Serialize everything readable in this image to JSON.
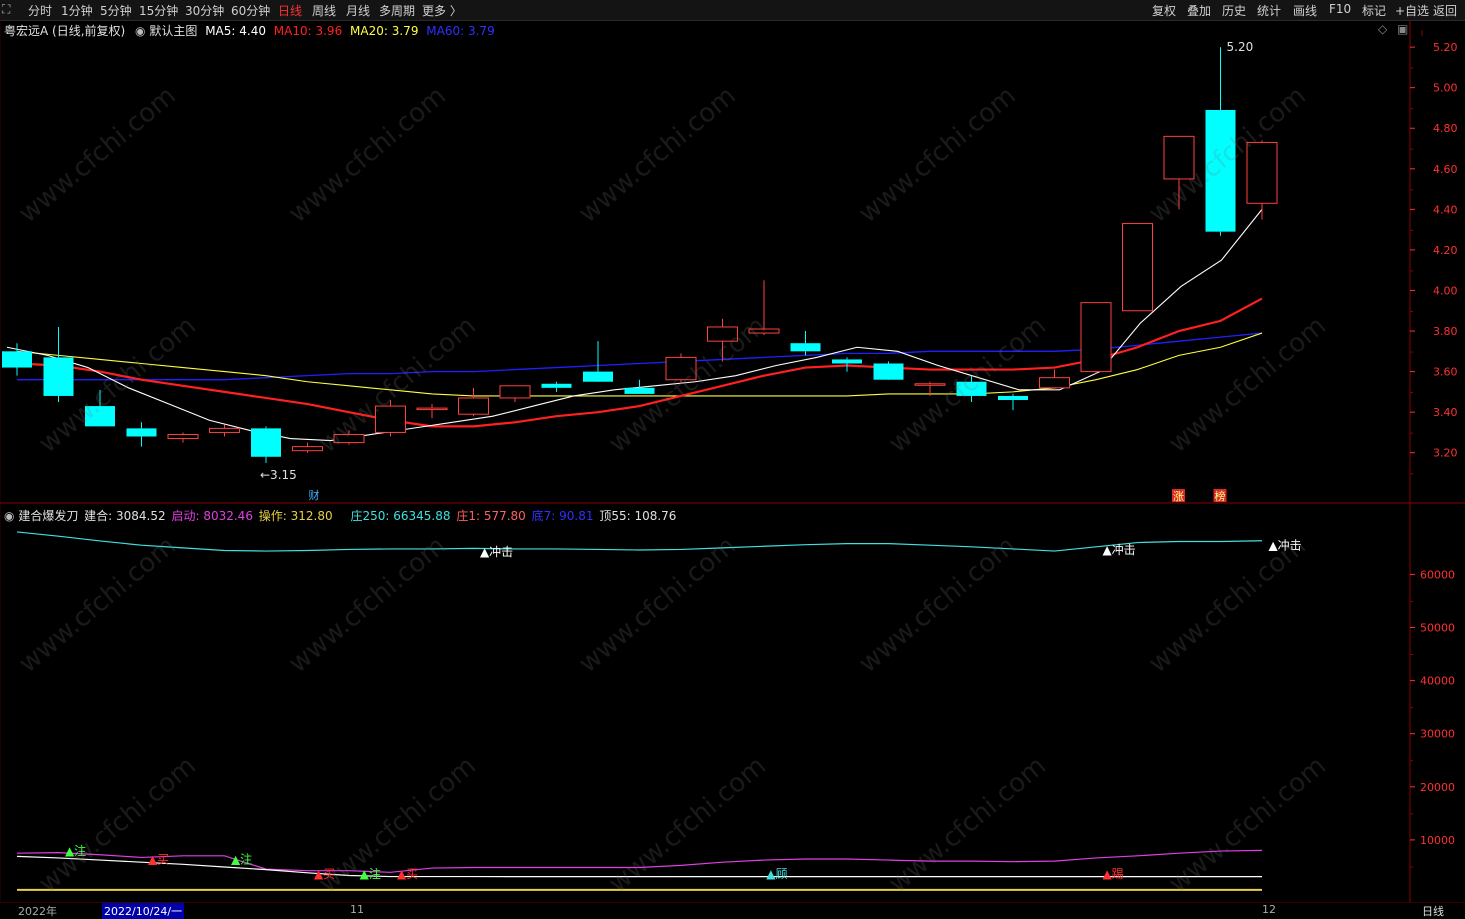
{
  "toolbar": {
    "periods": [
      "分时",
      "1分钟",
      "5分钟",
      "15分钟",
      "30分钟",
      "60分钟",
      "日线",
      "周线",
      "月线",
      "多周期",
      "更多 〉"
    ],
    "active_period": "日线",
    "right": [
      "复权",
      "叠加",
      "历史",
      "统计",
      "画线",
      "F10",
      "标记",
      "+自选",
      "返回"
    ]
  },
  "main_info": {
    "stock": "粤宏远A (日线,前复权)",
    "indicator": "默认主图",
    "ma5": "MA5: 4.40",
    "ma10": "MA10: 3.96",
    "ma20": "MA20: 3.79",
    "ma60": "MA60: 3.79"
  },
  "sub_info": {
    "name": "建合爆发刀",
    "jianhe": "建合: 3084.52",
    "qidong": "启动: 8032.46",
    "caozuo": "操作: 312.80",
    "zhuang250": "庄250: 66345.88",
    "zhuang1": "庄1: 577.80",
    "di7": "底7: 90.81",
    "ding55": "顶55: 108.76"
  },
  "colors": {
    "up": "#ff4040",
    "down": "#00ffff",
    "ma5": "#ffffff",
    "ma10": "#ff2020",
    "ma20": "#ffff40",
    "ma60": "#2020ff",
    "axis": "#ff3030",
    "qidong": "#e040e0",
    "caozuo": "#e8d040"
  },
  "chart_data": [
    {
      "type": "candlestick",
      "title": "粤宏远A (日线,前复权)",
      "y_ticks": [
        5.2,
        5.0,
        4.8,
        4.6,
        4.4,
        4.2,
        4.0,
        3.8,
        3.6,
        3.4,
        3.2
      ],
      "ylim": [
        3.1,
        5.24
      ],
      "ohlc": [
        [
          3.7,
          3.74,
          3.58,
          3.62
        ],
        [
          3.67,
          3.82,
          3.45,
          3.48
        ],
        [
          3.43,
          3.51,
          3.33,
          3.33
        ],
        [
          3.32,
          3.35,
          3.23,
          3.28
        ],
        [
          3.27,
          3.3,
          3.25,
          3.29
        ],
        [
          3.3,
          3.34,
          3.28,
          3.32
        ],
        [
          3.32,
          3.33,
          3.15,
          3.18
        ],
        [
          3.21,
          3.25,
          3.2,
          3.23
        ],
        [
          3.25,
          3.31,
          3.24,
          3.29
        ],
        [
          3.3,
          3.46,
          3.28,
          3.43
        ],
        [
          3.42,
          3.44,
          3.37,
          3.42
        ],
        [
          3.39,
          3.52,
          3.38,
          3.47
        ],
        [
          3.47,
          3.53,
          3.45,
          3.53
        ],
        [
          3.54,
          3.55,
          3.5,
          3.52
        ],
        [
          3.6,
          3.75,
          3.58,
          3.55
        ],
        [
          3.52,
          3.56,
          3.5,
          3.49
        ],
        [
          3.56,
          3.69,
          3.54,
          3.67
        ],
        [
          3.75,
          3.86,
          3.65,
          3.82
        ],
        [
          3.79,
          4.05,
          3.78,
          3.81
        ],
        [
          3.74,
          3.8,
          3.68,
          3.7
        ],
        [
          3.66,
          3.67,
          3.6,
          3.64
        ],
        [
          3.64,
          3.65,
          3.58,
          3.56
        ],
        [
          3.54,
          3.55,
          3.48,
          3.54
        ],
        [
          3.55,
          3.58,
          3.45,
          3.48
        ],
        [
          3.48,
          3.49,
          3.41,
          3.46
        ],
        [
          3.52,
          3.61,
          3.51,
          3.57
        ],
        [
          3.6,
          3.94,
          3.59,
          3.94
        ],
        [
          3.9,
          4.33,
          3.9,
          4.33
        ],
        [
          4.55,
          4.76,
          4.4,
          4.76
        ],
        [
          4.89,
          5.2,
          4.27,
          4.29
        ],
        [
          4.43,
          4.74,
          4.35,
          4.73
        ]
      ],
      "ma5": [
        3.72,
        3.68,
        3.62,
        3.52,
        3.44,
        3.36,
        3.31,
        3.27,
        3.26,
        3.29,
        3.32,
        3.35,
        3.38,
        3.43,
        3.48,
        3.51,
        3.53,
        3.55,
        3.58,
        3.63,
        3.67,
        3.72,
        3.7,
        3.63,
        3.57,
        3.51,
        3.51,
        3.6,
        3.84,
        4.02,
        4.15,
        4.4
      ],
      "ma10": [
        3.64,
        3.63,
        3.6,
        3.56,
        3.53,
        3.5,
        3.47,
        3.44,
        3.4,
        3.36,
        3.33,
        3.33,
        3.35,
        3.38,
        3.4,
        3.43,
        3.48,
        3.53,
        3.58,
        3.62,
        3.63,
        3.62,
        3.61,
        3.61,
        3.61,
        3.62,
        3.66,
        3.72,
        3.8,
        3.85,
        3.96
      ],
      "ma20": [
        3.7,
        3.68,
        3.66,
        3.64,
        3.62,
        3.6,
        3.58,
        3.55,
        3.53,
        3.51,
        3.49,
        3.48,
        3.48,
        3.48,
        3.48,
        3.48,
        3.48,
        3.48,
        3.48,
        3.48,
        3.48,
        3.49,
        3.49,
        3.49,
        3.5,
        3.52,
        3.56,
        3.61,
        3.68,
        3.72,
        3.79
      ],
      "ma60": [
        3.56,
        3.56,
        3.56,
        3.56,
        3.56,
        3.56,
        3.57,
        3.58,
        3.59,
        3.59,
        3.6,
        3.6,
        3.61,
        3.62,
        3.63,
        3.64,
        3.65,
        3.66,
        3.67,
        3.68,
        3.69,
        3.69,
        3.7,
        3.7,
        3.7,
        3.7,
        3.71,
        3.73,
        3.75,
        3.77,
        3.79
      ],
      "annotations": [
        "5.20",
        "←3.15",
        "财",
        "涨",
        "榜"
      ]
    },
    {
      "type": "line",
      "title": "建合爆发刀",
      "y_ticks": [
        60000,
        50000,
        40000,
        30000,
        20000,
        10000
      ],
      "ylim": [
        0,
        71000
      ],
      "series": [
        {
          "name": "庄250",
          "values": [
            68000,
            67200,
            66300,
            65500,
            65000,
            64500,
            64400,
            64500,
            64700,
            64800,
            64800,
            64900,
            64800,
            64800,
            64700,
            64600,
            64700,
            65000,
            65300,
            65600,
            65800,
            65800,
            65500,
            65200,
            64800,
            64400,
            65200,
            66000,
            66200,
            66200,
            66345.88
          ]
        },
        {
          "name": "启动",
          "values": [
            7500,
            7600,
            7200,
            6700,
            7000,
            7000,
            4500,
            4200,
            4200,
            3900,
            4700,
            4800,
            4800,
            4800,
            4800,
            4800,
            5200,
            5800,
            6200,
            6400,
            6400,
            6200,
            6000,
            6000,
            5900,
            6000,
            6600,
            7000,
            7500,
            7900,
            8032.46
          ]
        },
        {
          "name": "建合",
          "values": [
            6900,
            6600,
            6200,
            5800,
            5400,
            4900,
            4400,
            3800,
            3300,
            3100,
            3100,
            3100,
            3084,
            3084,
            3084,
            3084,
            3084,
            3084,
            3084,
            3084,
            3084,
            3084,
            3084,
            3084,
            3084,
            3084,
            3084,
            3084,
            3084,
            3084,
            3084.52
          ]
        }
      ],
      "markers": [
        "▲冲击",
        "▲冲击",
        "▲冲击",
        "▲注",
        "▲注",
        "▲注",
        "▲买",
        "▲买",
        "▲买",
        "▲顾",
        "▲踢"
      ]
    }
  ],
  "x_axis": {
    "year": "2022年",
    "date_box": "2022/10/24/一",
    "m11": "11",
    "m12": "12",
    "period": "日线"
  },
  "watermark": "www.cfchi.com"
}
